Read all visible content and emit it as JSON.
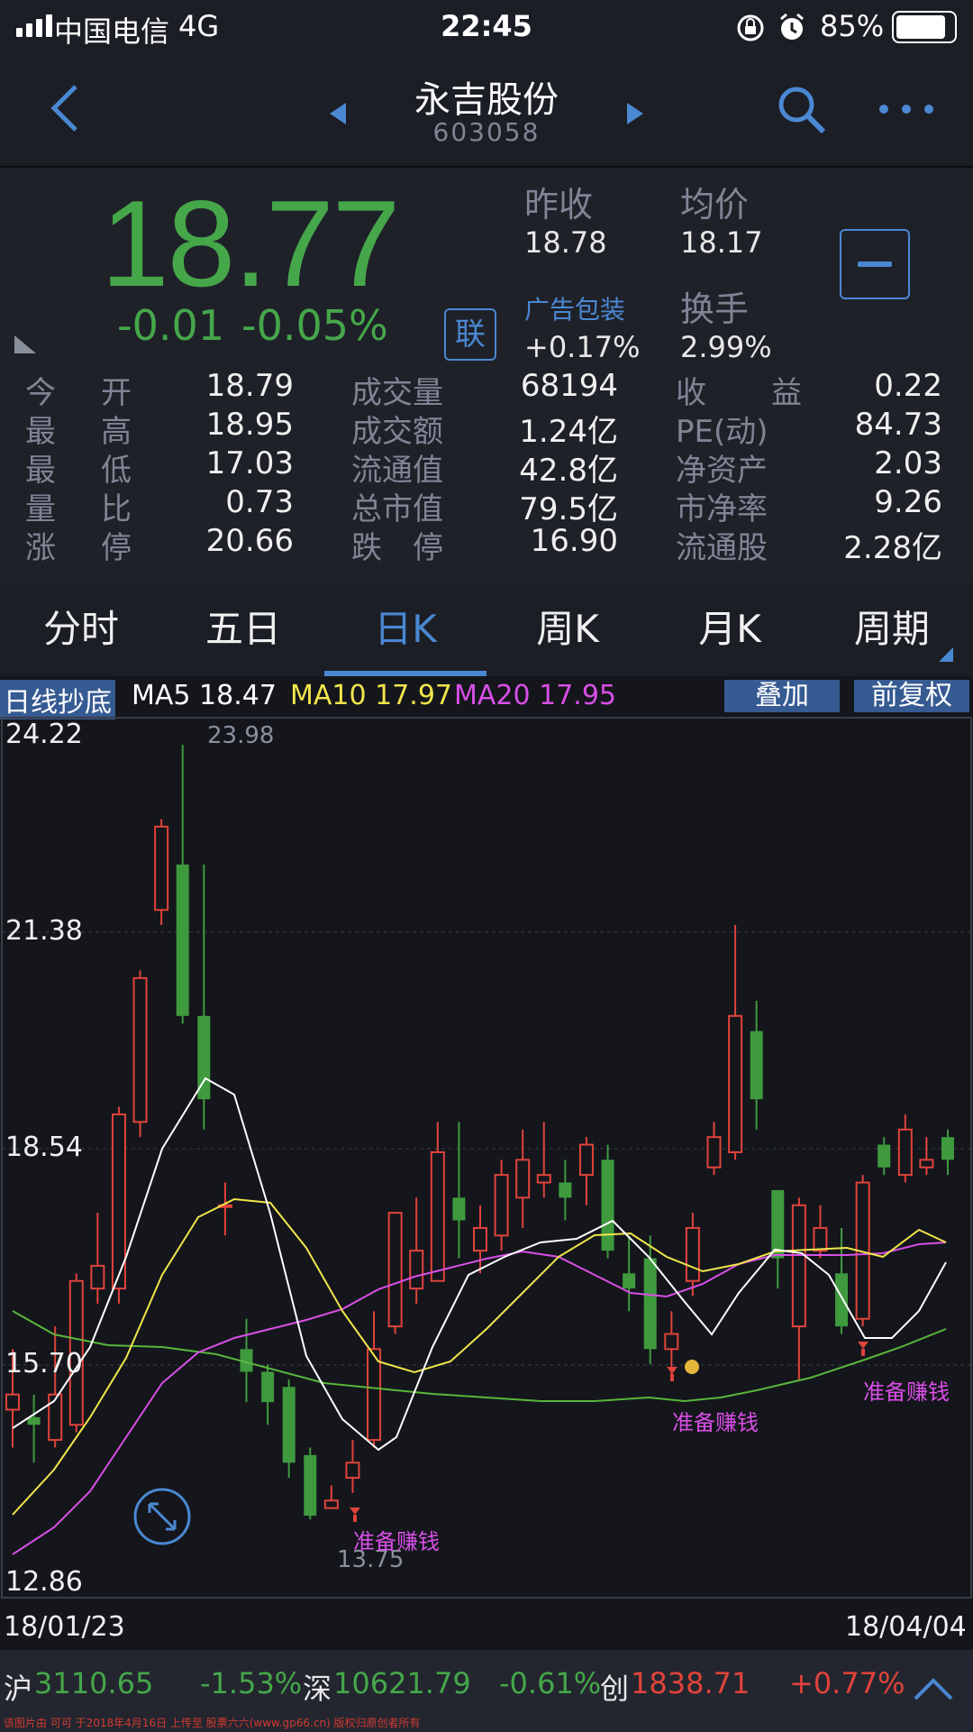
{
  "status_bar": {
    "carrier": "中国电信",
    "network": "4G",
    "time": "22:45",
    "battery": "85%"
  },
  "nav": {
    "stock_name": "永吉股份",
    "stock_code": "603058"
  },
  "quote": {
    "price": "18.77",
    "change": "-0.01",
    "change_pct": "-0.05%",
    "link_label": "联",
    "prev_close_label": "昨收",
    "prev_close": "18.78",
    "avg_label": "均价",
    "avg": "18.17",
    "ad_label": "广告包装",
    "ad_value": "+0.17%",
    "turnover_label": "换手",
    "turnover": "2.99%",
    "stats": [
      {
        "l1": "今",
        "l2": "开",
        "v1": "18.79",
        "m": "成交量",
        "v2": "68194",
        "r1": "收",
        "r2": "益",
        "v3": "0.22"
      },
      {
        "l1": "最",
        "l2": "高",
        "v1": "18.95",
        "m": "成交额",
        "v2": "1.24亿",
        "r1": "PE(动)",
        "r2": "",
        "v3": "84.73"
      },
      {
        "l1": "最",
        "l2": "低",
        "v1": "17.03",
        "m": "流通值",
        "v2": "42.8亿",
        "r1": "净资产",
        "r2": "",
        "v3": "2.03"
      },
      {
        "l1": "量",
        "l2": "比",
        "v1": "0.73",
        "m": "总市值",
        "v2": "79.5亿",
        "r1": "市净率",
        "r2": "",
        "v3": "9.26"
      },
      {
        "l1": "涨",
        "l2": "停",
        "v1": "20.66",
        "m": "跌　停",
        "v2": "16.90",
        "r1": "流通股",
        "r2": "",
        "v3": "2.28亿"
      }
    ]
  },
  "tabs": [
    "分时",
    "五日",
    "日K",
    "周K",
    "月K",
    "周期"
  ],
  "active_tab": "日K",
  "chart": {
    "indicator_label": "日线抄底",
    "ma5": "MA5 18.47",
    "ma10": "MA10 17.97",
    "ma20": "MA20 17.95",
    "overlay_button": "叠加",
    "adjust_button": "前复权",
    "axis_labels": [
      "24.22",
      "21.38",
      "18.54",
      "15.70",
      "12.86"
    ],
    "high_label": "23.98",
    "low_label": "13.75",
    "date_start": "18/01/23",
    "date_end": "18/04/04",
    "signal_text": "准备赚钱",
    "colors": {
      "up": "#e0433b",
      "down": "#3f9a3e",
      "ma5": "#ffffff",
      "ma10": "#f1e54a",
      "ma20": "#d94fe6",
      "ma60": "#59b63b",
      "signal": "#d94fe6",
      "accent": "#4a88d2"
    }
  },
  "chart_data": {
    "type": "candlestick",
    "ylim": [
      12.86,
      24.22
    ],
    "y_ticks": [
      24.22,
      21.38,
      18.54,
      15.7,
      12.86
    ],
    "candles": [
      {
        "o": 15.2,
        "c": 15.4,
        "h": 16.0,
        "l": 14.7
      },
      {
        "o": 15.1,
        "c": 15.0,
        "h": 15.4,
        "l": 14.5
      },
      {
        "o": 14.8,
        "c": 15.4,
        "h": 16.3,
        "l": 14.7
      },
      {
        "o": 15.0,
        "c": 16.9,
        "h": 17.0,
        "l": 14.9
      },
      {
        "o": 16.8,
        "c": 17.1,
        "h": 17.8,
        "l": 16.6
      },
      {
        "o": 16.8,
        "c": 19.1,
        "h": 19.2,
        "l": 16.6
      },
      {
        "o": 19.0,
        "c": 20.9,
        "h": 21.0,
        "l": 18.8
      },
      {
        "o": 21.8,
        "c": 22.9,
        "h": 23.0,
        "l": 21.6
      },
      {
        "o": 22.4,
        "c": 20.4,
        "h": 23.98,
        "l": 20.3
      },
      {
        "o": 20.4,
        "c": 19.3,
        "h": 22.4,
        "l": 18.9
      },
      {
        "o": 17.9,
        "c": 17.9,
        "h": 18.2,
        "l": 17.5
      },
      {
        "o": 16.0,
        "c": 15.7,
        "h": 16.4,
        "l": 15.3
      },
      {
        "o": 15.7,
        "c": 15.3,
        "h": 15.8,
        "l": 15.0
      },
      {
        "o": 15.5,
        "c": 14.5,
        "h": 15.6,
        "l": 14.3
      },
      {
        "o": 14.6,
        "c": 13.8,
        "h": 14.7,
        "l": 13.75
      },
      {
        "o": 13.9,
        "c": 14.0,
        "h": 14.2,
        "l": 13.9
      },
      {
        "o": 14.3,
        "c": 14.5,
        "h": 14.8,
        "l": 14.1
      },
      {
        "o": 14.8,
        "c": 16.0,
        "h": 16.5,
        "l": 14.7
      },
      {
        "o": 16.3,
        "c": 17.8,
        "h": 17.8,
        "l": 16.2
      },
      {
        "o": 16.8,
        "c": 17.3,
        "h": 18.0,
        "l": 16.6
      },
      {
        "o": 16.9,
        "c": 18.6,
        "h": 19.0,
        "l": 16.9
      },
      {
        "o": 18.0,
        "c": 17.7,
        "h": 19.0,
        "l": 17.2
      },
      {
        "o": 17.3,
        "c": 17.6,
        "h": 17.9,
        "l": 17.0
      },
      {
        "o": 17.5,
        "c": 18.3,
        "h": 18.5,
        "l": 17.3
      },
      {
        "o": 18.0,
        "c": 18.5,
        "h": 18.9,
        "l": 17.6
      },
      {
        "o": 18.2,
        "c": 18.3,
        "h": 19.0,
        "l": 18.0
      },
      {
        "o": 18.2,
        "c": 18.0,
        "h": 18.5,
        "l": 17.7
      },
      {
        "o": 18.3,
        "c": 18.7,
        "h": 18.8,
        "l": 17.9
      },
      {
        "o": 18.5,
        "c": 17.3,
        "h": 18.7,
        "l": 17.2
      },
      {
        "o": 17.0,
        "c": 16.8,
        "h": 17.5,
        "l": 16.5
      },
      {
        "o": 17.2,
        "c": 16.0,
        "h": 17.5,
        "l": 15.8
      },
      {
        "o": 16.0,
        "c": 16.2,
        "h": 16.5,
        "l": 15.6
      },
      {
        "o": 16.9,
        "c": 17.6,
        "h": 17.8,
        "l": 16.7
      },
      {
        "o": 18.4,
        "c": 18.8,
        "h": 19.0,
        "l": 18.3
      },
      {
        "o": 18.6,
        "c": 20.4,
        "h": 21.6,
        "l": 18.5
      },
      {
        "o": 20.2,
        "c": 19.3,
        "h": 20.6,
        "l": 18.9
      },
      {
        "o": 18.1,
        "c": 17.2,
        "h": 18.1,
        "l": 16.8
      },
      {
        "o": 16.3,
        "c": 17.9,
        "h": 18.0,
        "l": 15.6
      },
      {
        "o": 17.3,
        "c": 17.6,
        "h": 17.9,
        "l": 17.2
      },
      {
        "o": 17.0,
        "c": 16.3,
        "h": 17.6,
        "l": 16.2
      },
      {
        "o": 16.4,
        "c": 18.2,
        "h": 18.3,
        "l": 16.3
      },
      {
        "o": 18.7,
        "c": 18.4,
        "h": 18.8,
        "l": 18.3
      },
      {
        "o": 18.3,
        "c": 18.9,
        "h": 19.1,
        "l": 18.2
      },
      {
        "o": 18.4,
        "c": 18.5,
        "h": 18.8,
        "l": 18.3
      },
      {
        "o": 18.8,
        "c": 18.5,
        "h": 18.9,
        "l": 18.3
      }
    ]
  },
  "index_bar": {
    "sh_label": "沪",
    "sh_value": "3110.65",
    "sh_pct": "-1.53%",
    "sz_label": "深",
    "sz_value": "10621.79",
    "sz_pct": "-0.61%",
    "cy_label": "创",
    "cy_value": "1838.71",
    "cy_pct": "+0.77%"
  },
  "watermark": "该图片由 可可 于2018年4月16日 上传至 股票六六(www.gp66.cn) 版权归原创者所有"
}
